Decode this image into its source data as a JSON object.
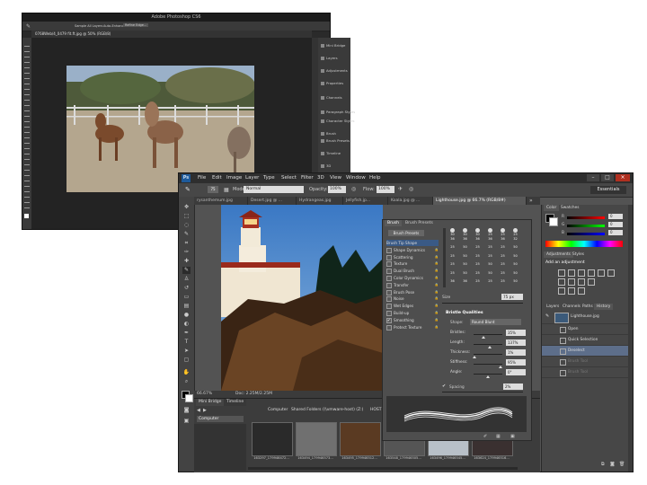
{
  "back_window": {
    "title": "Adobe Photoshop CS6",
    "doc_tab": "0768Web/4_0479 fit.ft.jpg @ 50% (RGB/8)",
    "options": [
      "Sample All Layers",
      "Auto-Enhance",
      "Refine Edge..."
    ],
    "dock_panels": [
      "Mini Bridge",
      "Layers",
      "Adjustments",
      "Properties",
      "Channels",
      "Paragraph Styles",
      "Character Styles",
      "Brush",
      "Brush Presets",
      "Timeline",
      "3D"
    ]
  },
  "front_window": {
    "logo": "Ps",
    "menu": [
      "File",
      "Edit",
      "Image",
      "Layer",
      "Type",
      "Select",
      "Filter",
      "3D",
      "View",
      "Window",
      "Help"
    ],
    "window_controls": [
      "–",
      "□",
      "×"
    ],
    "options": {
      "mode_label": "Mode:",
      "mode_value": "Normal",
      "opacity_label": "Opacity:",
      "opacity_value": "100%",
      "flow_label": "Flow:",
      "flow_value": "100%"
    },
    "workspace": "Essentials",
    "doc_tabs": [
      "rysanthemum.jpg",
      "Desert.jpg @ ...",
      "Hydrangeas.jpg",
      "Jellyfish.jp...",
      "Koala.jpg @ ...",
      "Lighthouse.jpg @ 66.7% (RGB/8#)"
    ],
    "overflow": "»",
    "status": {
      "zoom": "66.67%",
      "doc_size": "Doc: 2.25M/2.25M"
    },
    "bridge": {
      "tabs": [
        "Mini Bridge",
        "Timeline"
      ],
      "path": [
        "Computer",
        "Shared Folders (\\\\vmware-host) (Z:)",
        "HOST C"
      ],
      "location": "Computer",
      "thumbnails": [
        "163297_179946472...",
        "163494_179946573...",
        "163495_179946512...",
        "163548_179946505...",
        "163496_179946545...",
        "163624_179946516..."
      ]
    },
    "brush_panel": {
      "tabs": [
        "Brush",
        "Brush Presets"
      ],
      "presets_button": "Brush Presets",
      "options": [
        "Brush Tip Shape",
        "Shape Dynamics",
        "Scattering",
        "Texture",
        "Dual Brush",
        "Color Dynamics",
        "Transfer",
        "Brush Pose",
        "Noise",
        "Wet Edges",
        "Build-up",
        "Smoothing",
        "Protect Texture"
      ],
      "checked": [
        "Smoothing"
      ],
      "tip_sizes": [
        "30",
        "30",
        "30",
        "25",
        "25",
        "25",
        "36",
        "36",
        "36",
        "36",
        "36",
        "32",
        "25",
        "50",
        "25",
        "25",
        "25",
        "50",
        "25",
        "50",
        "25",
        "25",
        "25",
        "50",
        "25",
        "50",
        "25",
        "50",
        "25",
        "50",
        "25",
        "50",
        "25",
        "50",
        "25",
        "50",
        "36",
        "36",
        "25",
        "25",
        "25",
        "50"
      ],
      "size_label": "Size",
      "size_value": "75 px",
      "qualities_title": "Bristle Qualities",
      "shape_label": "Shape:",
      "shape_value": "Round Blunt",
      "rows": [
        {
          "label": "Bristles:",
          "value": "35%",
          "pos": 0.35
        },
        {
          "label": "Length:",
          "value": "137%",
          "pos": 0.55
        },
        {
          "label": "Thickness:",
          "value": "1%",
          "pos": 0.02
        },
        {
          "label": "Stiffness:",
          "value": "95%",
          "pos": 0.95
        },
        {
          "label": "Angle:",
          "value": "0°",
          "pos": 0.5
        }
      ],
      "spacing_label": "Spacing",
      "spacing_value": "2%"
    },
    "color_panel": {
      "tabs": [
        "Color",
        "Swatches"
      ],
      "channels": [
        {
          "label": "R",
          "value": "0"
        },
        {
          "label": "G",
          "value": "0"
        },
        {
          "label": "B",
          "value": "0"
        }
      ]
    },
    "adjustments": {
      "tabs": [
        "Adjustments",
        "Styles"
      ],
      "title": "Add an adjustment"
    },
    "history": {
      "tabs": [
        "Layers",
        "Channels",
        "Paths",
        "History"
      ],
      "snapshot": "Lighthouse.jpg",
      "states": [
        {
          "label": "Open",
          "state": "normal"
        },
        {
          "label": "Quick Selection",
          "state": "normal"
        },
        {
          "label": "Deselect",
          "state": "selected"
        },
        {
          "label": "Brush Tool",
          "state": "dim"
        },
        {
          "label": "Brush Tool",
          "state": "dim"
        }
      ]
    }
  }
}
